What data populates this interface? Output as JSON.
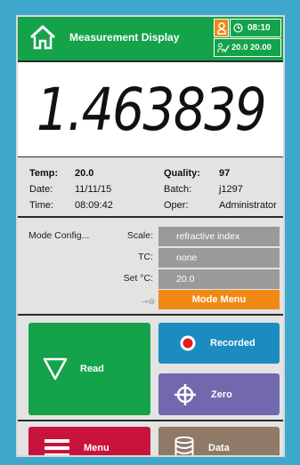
{
  "header": {
    "title": "Measurement Display",
    "time": "08:10",
    "tolerance": "20.0 20.00"
  },
  "reading": {
    "value": "1.463839"
  },
  "info": {
    "temp_label": "Temp:",
    "temp_value": "20.0",
    "date_label": "Date:",
    "date_value": "11/11/15",
    "time_label": "Time:",
    "time_value": "08:09:42",
    "quality_label": "Quality:",
    "quality_value": "97",
    "batch_label": "Batch:",
    "batch_value": "j1297",
    "oper_label": "Oper:",
    "oper_value": "Administrator"
  },
  "mode": {
    "title": "Mode Config...",
    "scale_label": "Scale:",
    "scale_value": "refractive index",
    "tc_label": "TC:",
    "tc_value": "none",
    "setc_label": "Set °C:",
    "setc_value": "20.0",
    "menu_label": "Mode Menu"
  },
  "buttons": {
    "read": "Read",
    "recorded": "Recorded",
    "zero": "Zero",
    "menu": "Menu",
    "data": "Data"
  },
  "colors": {
    "header_green": "#14a34a",
    "accent_orange": "#f08a14",
    "recorded_blue": "#1c8cc0",
    "zero_purple": "#7168ad",
    "menu_red": "#c8143c",
    "data_brown": "#8e7a67",
    "frame_bg": "#3ea8cc"
  }
}
